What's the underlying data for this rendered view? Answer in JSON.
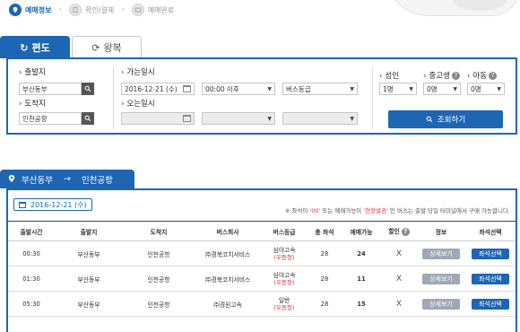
{
  "steps": [
    {
      "label": "예매정보",
      "active": true
    },
    {
      "label": "확인/결제",
      "active": false
    },
    {
      "label": "예매완료",
      "active": false
    }
  ],
  "trip_tabs": {
    "oneway": "편도",
    "round": "왕복"
  },
  "search": {
    "departure_label": "출발지",
    "departure_value": "부산동부",
    "arrival_label": "도착지",
    "arrival_value": "인천공항",
    "depart_date_label": "가는일시",
    "depart_date_value": "2016-12-21 (수)",
    "depart_time_value": "00:00 이후",
    "bus_grade_value": "버스등급",
    "return_date_label": "오는일시",
    "adult_label": "성인",
    "adult_value": "1명",
    "youth_label": "중고생",
    "youth_value": "0명",
    "child_label": "아동",
    "child_value": "0명",
    "help_glyph": "?",
    "submit_label": "조회하기"
  },
  "results": {
    "route_from": "부산동부",
    "route_arrow": "→",
    "route_to": "인천공항",
    "date": "2016-12-21 (수)",
    "notice_prefix": "※ 좌석이 ",
    "notice_zero": "'00'",
    "notice_mid": " 또는 예매가능이 ",
    "notice_onsite": "'현장발권'",
    "notice_suffix": " 인 버스는 출발 당일 터미널에서 구매 가능합니다.",
    "columns": [
      "출발시간",
      "출발지",
      "도착지",
      "버스회사",
      "버스등급",
      "총 좌석",
      "예매가능",
      "할인",
      "정보",
      "좌석선택"
    ],
    "discount_help": "?",
    "rows": [
      {
        "time": "00:30",
        "from": "부산동부",
        "to": "인천공항",
        "company": "㈜경북코치서비스",
        "grade": "심야고속",
        "grade_sub": "(우등형)",
        "total": "28",
        "avail": "24",
        "discount": "X",
        "detail": "상세보기",
        "select": "좌석선택"
      },
      {
        "time": "01:30",
        "from": "부산동부",
        "to": "인천공항",
        "company": "㈜경북코치서비스",
        "grade": "심야고속",
        "grade_sub": "(우등형)",
        "total": "28",
        "avail": "11",
        "discount": "X",
        "detail": "상세보기",
        "select": "좌석선택"
      },
      {
        "time": "05:30",
        "from": "부산동부",
        "to": "인천공항",
        "company": "㈜경원고속",
        "grade": "일반",
        "grade_sub": "(우등형)",
        "total": "28",
        "avail": "15",
        "discount": "X",
        "detail": "상세보기",
        "select": "좌석선택"
      }
    ]
  },
  "colors": {
    "primary": "#1e66b3",
    "alert": "#d33333",
    "button_gray": "#9ea9b5"
  }
}
